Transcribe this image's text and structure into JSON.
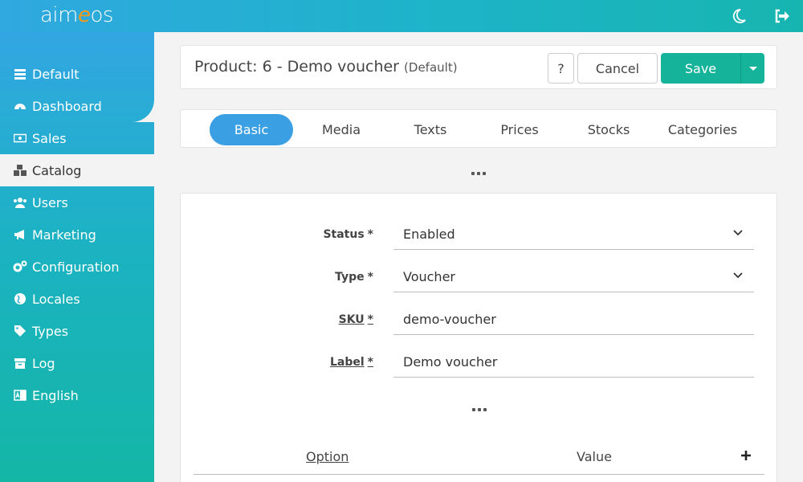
{
  "app": {
    "logo_a": "aim",
    "logo_e": "e",
    "logo_b": "os"
  },
  "sidebar": {
    "items": [
      {
        "label": "Default",
        "icon": "server-icon"
      },
      {
        "label": "Dashboard",
        "icon": "gauge-icon"
      },
      {
        "label": "Sales",
        "icon": "money-bill-icon"
      },
      {
        "label": "Catalog",
        "icon": "cubes-icon",
        "active": true
      },
      {
        "label": "Users",
        "icon": "users-icon"
      },
      {
        "label": "Marketing",
        "icon": "bullhorn-icon"
      },
      {
        "label": "Configuration",
        "icon": "cogs-icon"
      },
      {
        "label": "Locales",
        "icon": "globe-icon"
      },
      {
        "label": "Types",
        "icon": "tag-icon"
      },
      {
        "label": "Log",
        "icon": "archive-icon"
      },
      {
        "label": "English",
        "icon": "language-icon"
      }
    ]
  },
  "header": {
    "title": "Product: 6 - Demo voucher",
    "site": "(Default)",
    "help_label": "?",
    "cancel_label": "Cancel",
    "save_label": "Save"
  },
  "tabs": [
    {
      "label": "Basic",
      "active": true
    },
    {
      "label": "Media"
    },
    {
      "label": "Texts"
    },
    {
      "label": "Prices"
    },
    {
      "label": "Stocks"
    },
    {
      "label": "Categories"
    }
  ],
  "form": {
    "status": {
      "label": "Status",
      "required": "*",
      "value": "Enabled"
    },
    "type": {
      "label": "Type",
      "required": "*",
      "value": "Voucher"
    },
    "sku": {
      "label": "SKU",
      "required": "*",
      "value": "demo-voucher"
    },
    "label": {
      "label": "Label",
      "required": "*",
      "value": "Demo voucher"
    },
    "options": {
      "col_option": "Option",
      "col_value": "Value",
      "add": "+"
    }
  },
  "colors": {
    "accent": "#3b9fe3",
    "save": "#14b39a",
    "logo_e": "#f39a1d"
  }
}
